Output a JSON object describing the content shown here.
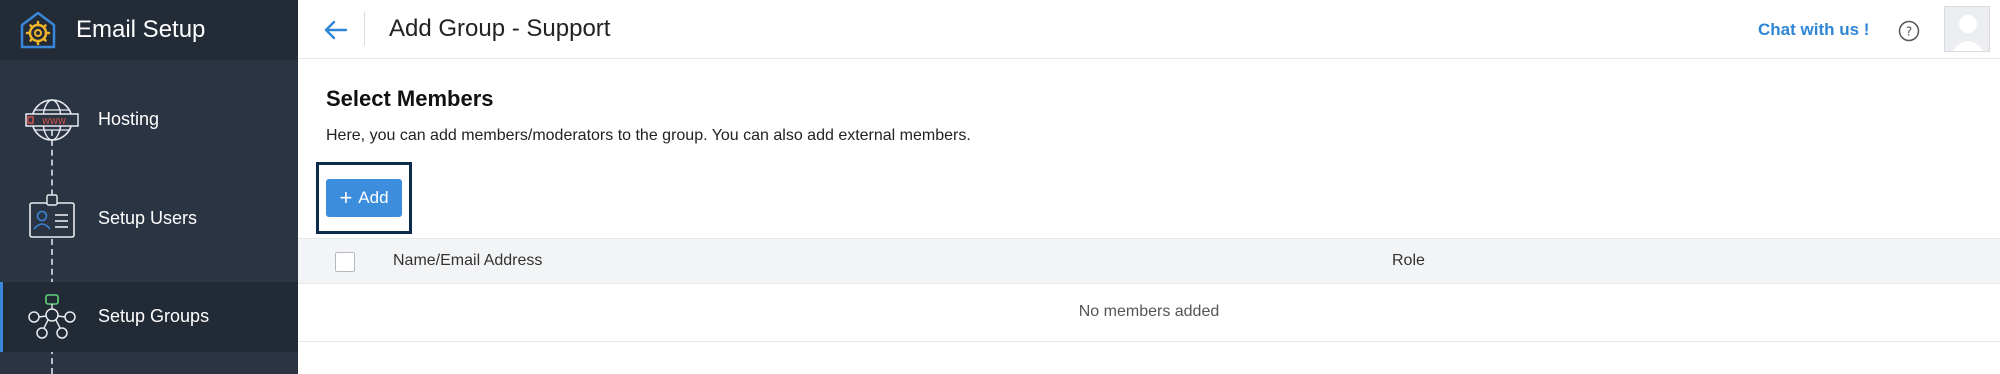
{
  "sidebar": {
    "brand_title": "Email Setup",
    "items": [
      {
        "label": "Hosting",
        "icon": "globe-www-icon",
        "active": false
      },
      {
        "label": "Setup Users",
        "icon": "id-badge-icon",
        "active": false
      },
      {
        "label": "Setup Groups",
        "icon": "group-network-icon",
        "active": true
      }
    ]
  },
  "header": {
    "title": "Add Group - Support",
    "chat_link": "Chat with us !",
    "help_icon": "question-circle-icon",
    "back_icon": "arrow-left-icon"
  },
  "main": {
    "section_title": "Select Members",
    "description": "Here, you can add members/moderators to the group. You can also add external members.",
    "add_button_label": "Add",
    "table": {
      "columns": [
        "Name/Email Address",
        "Role"
      ],
      "empty_message": "No members added"
    }
  },
  "colors": {
    "sidebar_bg": "#2b3442",
    "accent": "#3c8ddc",
    "link": "#2f86d4",
    "highlight_border": "#0d2c4d"
  }
}
